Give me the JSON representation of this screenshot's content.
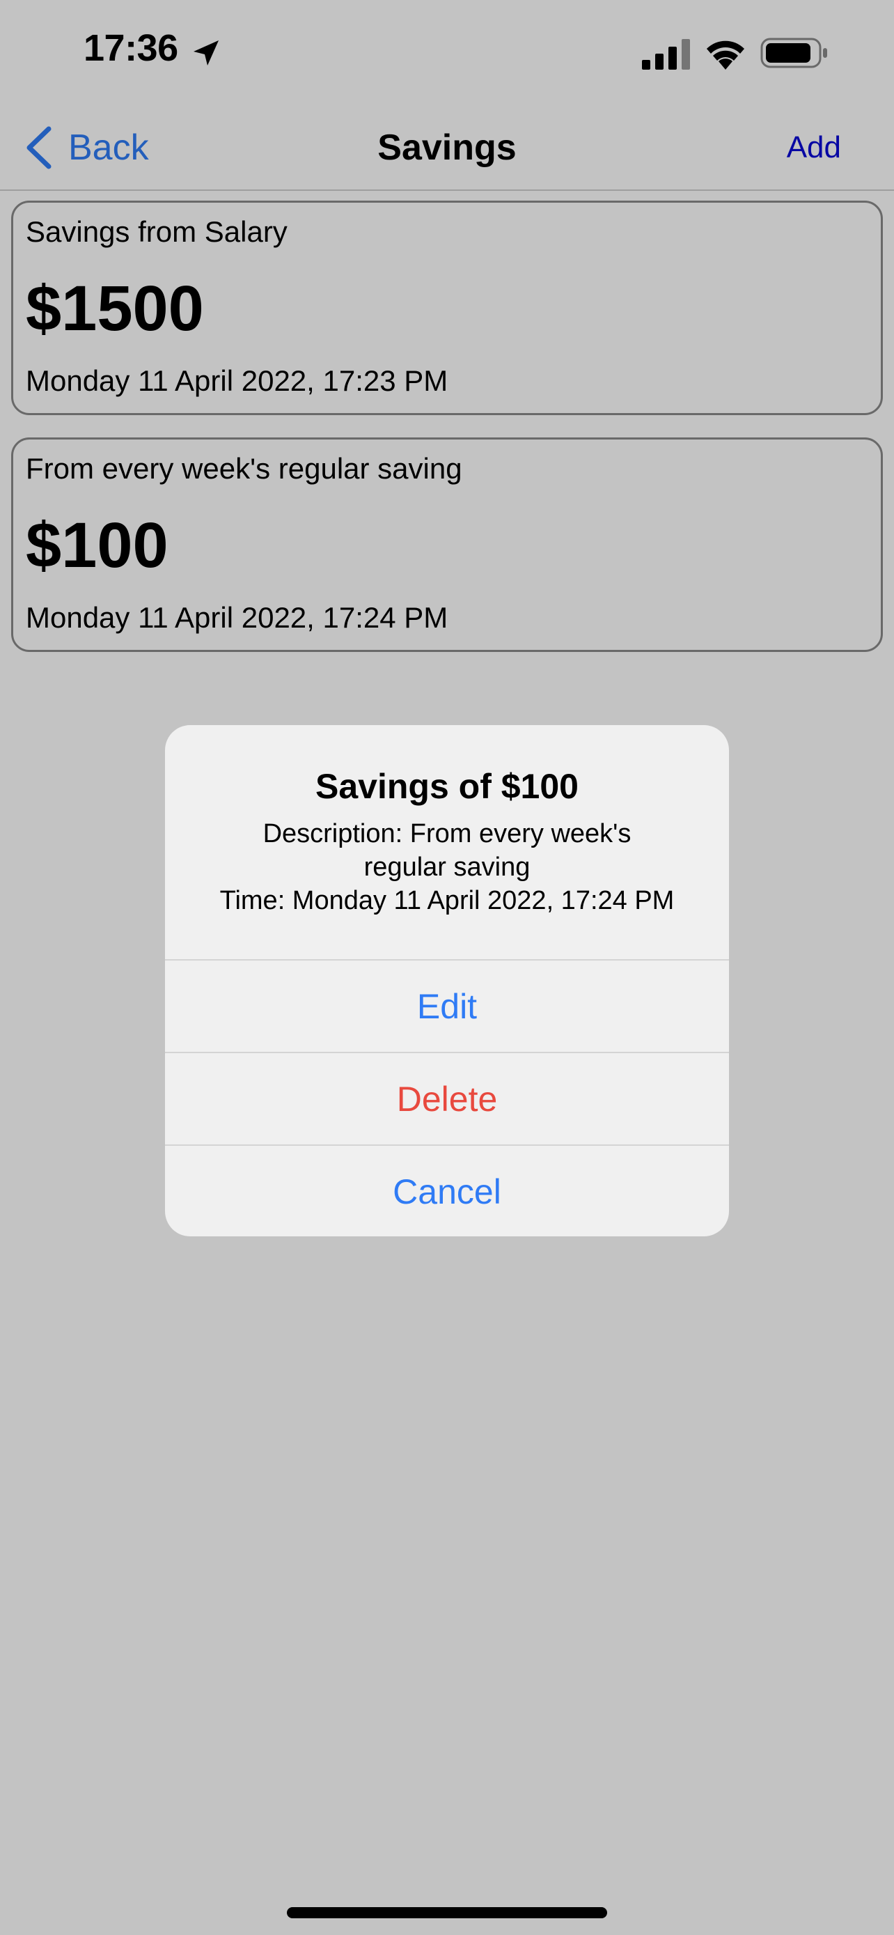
{
  "status_bar": {
    "time": "17:36"
  },
  "nav": {
    "back_label": "Back",
    "title": "Savings",
    "add_label": "Add"
  },
  "savings": [
    {
      "description": "Savings from Salary",
      "amount": "$1500",
      "time": "Monday 11 April 2022, 17:23 PM"
    },
    {
      "description": "From every week's regular saving",
      "amount": "$100",
      "time": "Monday 11 April 2022, 17:24 PM"
    }
  ],
  "alert": {
    "title": "Savings of $100",
    "description_line": "Description: From every week's\nregular saving",
    "time_line": "Time: Monday 11 April 2022, 17:24 PM",
    "edit_label": "Edit",
    "delete_label": "Delete",
    "cancel_label": "Cancel"
  },
  "colors": {
    "accent_blue": "#2f7bf5",
    "add_blue": "#0a0ad6",
    "destructive_red": "#e8493e"
  }
}
